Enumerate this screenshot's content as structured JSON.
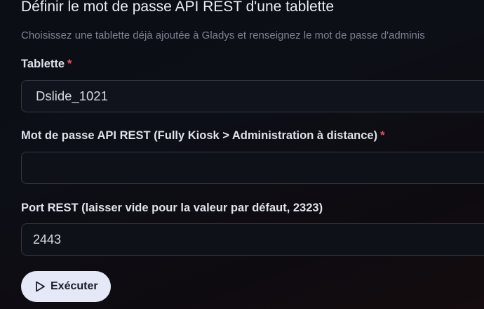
{
  "header": {
    "title": "Définir le mot de passe API REST d'une tablette",
    "subtitle": "Choisissez une tablette déjà ajoutée à Gladys et renseignez le mot de passe d'adminis"
  },
  "form": {
    "tablet": {
      "label": "Tablette",
      "required_mark": "*",
      "value": "Dslide_1021"
    },
    "password": {
      "label": "Mot de passe API REST (Fully Kiosk > Administration à distance)",
      "required_mark": "*",
      "value": ""
    },
    "port": {
      "label": "Port REST (laisser vide pour la valeur par défaut, 2323)",
      "value": "2443"
    },
    "submit": {
      "label": "Exécuter",
      "icon": "play-icon"
    }
  }
}
